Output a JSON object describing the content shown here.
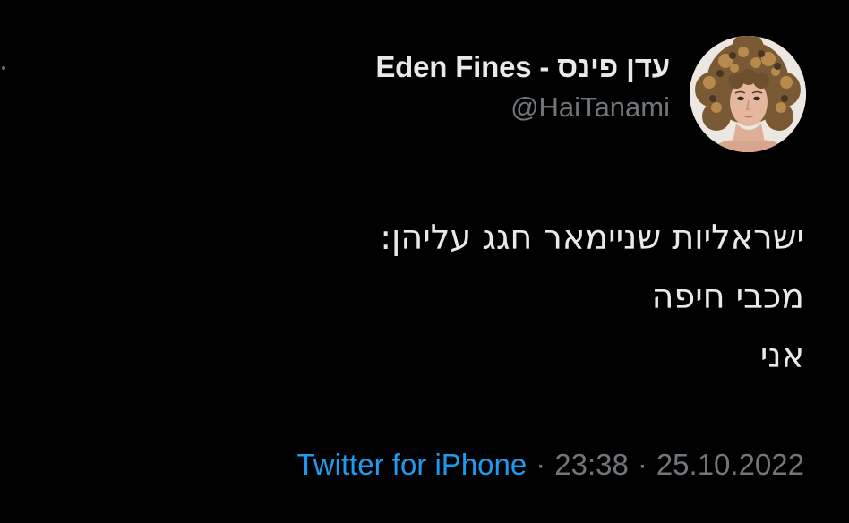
{
  "tweet": {
    "author": {
      "display_name": "Eden Fines - עדן פינס",
      "handle": "@HaiTanami",
      "avatar_icon": "profile-photo-curly-hair"
    },
    "body_lines": [
      "ישראליות שניימאר חגג עליהן:",
      "מכבי חיפה",
      "אני"
    ],
    "meta": {
      "source": "Twitter for iPhone",
      "separator": "·",
      "time": "23:38",
      "date": "25.10.2022"
    }
  },
  "colors": {
    "background": "#000000",
    "text": "#e7e9ea",
    "muted": "#71767b",
    "link": "#1d9bf0"
  }
}
